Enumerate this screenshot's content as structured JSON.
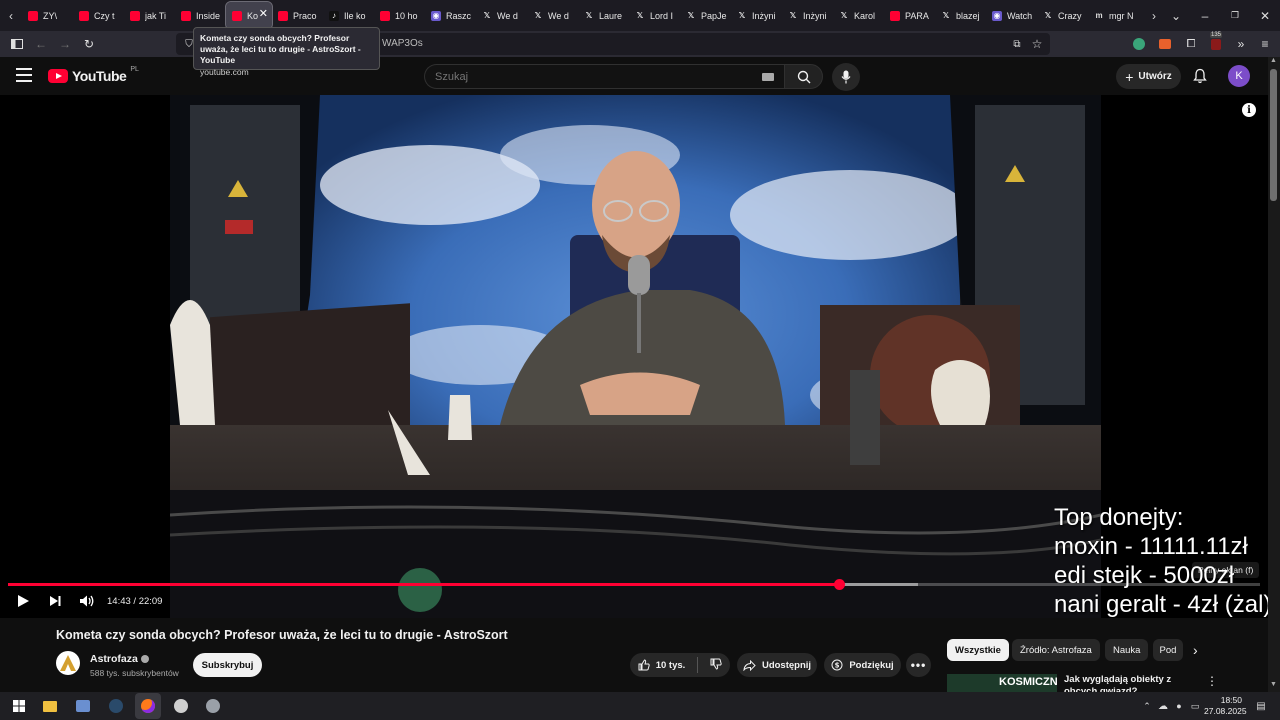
{
  "browser": {
    "tabs": [
      {
        "label": "ZY\\",
        "icon": "youtube-icon",
        "active": false
      },
      {
        "label": "Czy t",
        "icon": "youtube-icon",
        "active": false
      },
      {
        "label": "jak Ti",
        "icon": "youtube-icon",
        "active": false
      },
      {
        "label": "Inside",
        "icon": "youtube-icon",
        "active": false
      },
      {
        "label": "Ko",
        "icon": "youtube-icon",
        "active": true
      },
      {
        "label": "Praco",
        "icon": "youtube-icon",
        "active": false
      },
      {
        "label": "Ile ko",
        "icon": "tiktok-icon",
        "active": false
      },
      {
        "label": "10 ho",
        "icon": "youtube-icon",
        "active": false
      },
      {
        "label": "Raszc",
        "icon": "twitch-icon",
        "active": false
      },
      {
        "label": "We d",
        "icon": "x-icon",
        "active": false
      },
      {
        "label": "We d",
        "icon": "x-icon",
        "active": false
      },
      {
        "label": "Laure",
        "icon": "x-icon",
        "active": false
      },
      {
        "label": "Lord I",
        "icon": "x-icon",
        "active": false
      },
      {
        "label": "PapJe",
        "icon": "x-icon",
        "active": false
      },
      {
        "label": "Inżyni",
        "icon": "x-icon",
        "active": false
      },
      {
        "label": "Inżyni",
        "icon": "x-icon",
        "active": false
      },
      {
        "label": "Karol",
        "icon": "x-icon",
        "active": false
      },
      {
        "label": "PARA",
        "icon": "youtube-icon",
        "active": false
      },
      {
        "label": "blazej",
        "icon": "x-icon",
        "active": false
      },
      {
        "label": "Watch",
        "icon": "twitch-icon",
        "active": false
      },
      {
        "label": "Crazy",
        "icon": "x-icon",
        "active": false
      },
      {
        "label": "mgr N",
        "icon": "m-icon",
        "active": false
      }
    ],
    "url_partial": "WAP3Os",
    "tooltip": {
      "title": "Kometa czy sonda obcych? Profesor uważa, że leci tu to drugie - AstroSzort - YouTube",
      "domain": "youtube.com"
    },
    "extension_badge": "135"
  },
  "youtube": {
    "logo_text": "YouTube",
    "country_code": "PL",
    "search": {
      "placeholder": "Szukaj"
    },
    "create_label": "Utwórz",
    "avatar_letter": "K"
  },
  "player": {
    "time": "14:43 / 22:09",
    "progress_fraction": 0.664,
    "buffered_fraction": 0.727,
    "fullscreen_tip": "Pełny ekran (f)",
    "overlay_lines": [
      "Top donejty:",
      "moxin - 11111.11zł",
      "edi stejk - 5000zł",
      "nani geralt - 4zł (żal)"
    ]
  },
  "video": {
    "title": "Kometa czy sonda obcych? Profesor uważa, że leci tu to drugie - AstroSzort",
    "channel": "Astrofaza",
    "subscribers": "588 tys. subskrybentów",
    "subscribe_label": "Subskrybuj",
    "likes": "10 tys.",
    "share_label": "Udostępnij",
    "thanks_label": "Podziękuj"
  },
  "chips": [
    "Wszystkie",
    "Źródło: Astrofaza",
    "Nauka",
    "Pod"
  ],
  "recommendation": {
    "thumb_text": "KOSMICZNI",
    "title": "Jak wyglądają obiekty z obcych gwiazd?"
  },
  "taskbar": {
    "time": "18:50",
    "date": "27.08.2025"
  },
  "colors": {
    "youtube_red": "#ff0033",
    "background": "#0f0f0f",
    "chip_bg": "#272727"
  }
}
